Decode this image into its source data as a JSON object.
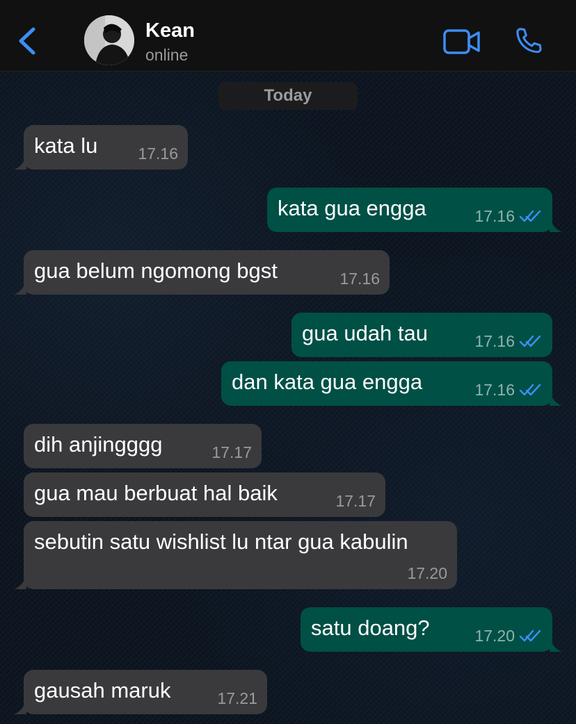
{
  "header": {
    "contact_name": "Kean",
    "status": "online",
    "icons": {
      "back": "chevron-left-icon",
      "video": "video-camera-icon",
      "call": "phone-icon"
    },
    "accent_color": "#3d8ef5"
  },
  "date_chip": "Today",
  "colors": {
    "incoming": "#3a3a3c",
    "outgoing": "#005046",
    "read_ticks": "#3d8ef5"
  },
  "messages": [
    {
      "direction": "in",
      "text": "kata lu",
      "time": "17.16"
    },
    {
      "direction": "out",
      "text": "kata gua engga",
      "time": "17.16",
      "status": "read"
    },
    {
      "direction": "in",
      "text": "gua belum ngomong bgst",
      "time": "17.16"
    },
    {
      "direction": "out",
      "text": "gua udah tau",
      "time": "17.16",
      "status": "read"
    },
    {
      "direction": "out",
      "text": "dan kata gua engga",
      "time": "17.16",
      "status": "read"
    },
    {
      "direction": "in",
      "text": "dih anjingggg",
      "time": "17.17"
    },
    {
      "direction": "in",
      "text": "gua mau berbuat hal baik",
      "time": "17.17"
    },
    {
      "direction": "in",
      "text": "sebutin satu wishlist lu ntar gua kabulin",
      "time": "17.20"
    },
    {
      "direction": "out",
      "text": "satu doang?",
      "time": "17.20",
      "status": "read"
    },
    {
      "direction": "in",
      "text": "gausah maruk",
      "time": "17.21"
    }
  ]
}
